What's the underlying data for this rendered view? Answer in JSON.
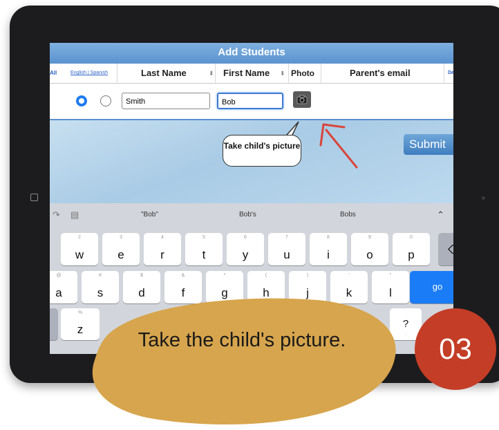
{
  "app": {
    "title": "Add Students"
  },
  "table": {
    "headers": {
      "all": "All",
      "language": "English | Spanish",
      "last_name": "Last Name",
      "sort_icon": "sort-arrows-icon",
      "first_name": "First Name",
      "photo": "Photo",
      "parent_email": "Parent's email",
      "delete": "De"
    },
    "row": {
      "last_name_value": "Smith",
      "first_name_value": "Bob",
      "language_selected": "English",
      "photo_button_icon": "camera-icon"
    }
  },
  "callout": {
    "text": "Take child's picture"
  },
  "submit_label": "Submit",
  "keyboard": {
    "suggestions": [
      "\"Bob\"",
      "Bob's",
      "Bobs"
    ],
    "row1": [
      {
        "k": "w",
        "s": "2"
      },
      {
        "k": "e",
        "s": "3"
      },
      {
        "k": "r",
        "s": "4"
      },
      {
        "k": "t",
        "s": "5"
      },
      {
        "k": "y",
        "s": "6"
      },
      {
        "k": "u",
        "s": "7"
      },
      {
        "k": "i",
        "s": "8"
      },
      {
        "k": "o",
        "s": "9"
      },
      {
        "k": "p",
        "s": "0"
      }
    ],
    "row2": [
      {
        "k": "a",
        "s": "@"
      },
      {
        "k": "s",
        "s": "#"
      },
      {
        "k": "d",
        "s": "$"
      },
      {
        "k": "f",
        "s": "&"
      },
      {
        "k": "g",
        "s": "*"
      },
      {
        "k": "h",
        "s": "("
      },
      {
        "k": "j",
        "s": ")"
      },
      {
        "k": "k",
        "s": "'"
      },
      {
        "k": "l",
        "s": "\""
      }
    ],
    "row3": [
      {
        "k": "z",
        "s": "%"
      }
    ],
    "go_label": "go",
    "punct_key": "?",
    "punct_sub": ".",
    "icons": [
      "redo-icon",
      "clipboard-icon",
      "chevron-up-icon",
      "delete-icon"
    ]
  },
  "caption": {
    "text": "Take the child's picture."
  },
  "step_badge": "03",
  "colors": {
    "accent_blue": "#1a7cf7",
    "header_blue": "#5a93cf",
    "blob_gold": "#d7a54d",
    "badge_red": "#c43d26",
    "arrow_red": "#d8453a"
  }
}
